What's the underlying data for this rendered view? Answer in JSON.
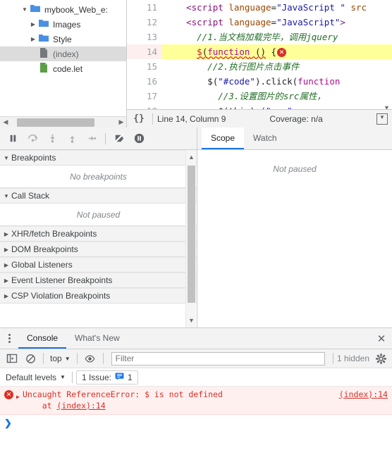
{
  "navigator": {
    "tree": [
      {
        "label": "mybook_Web_e:",
        "icon": "folder-icon",
        "twisty": "▼",
        "depth": 1,
        "type": "folder",
        "selected": false
      },
      {
        "label": "Images",
        "icon": "folder-icon",
        "twisty": "▶",
        "depth": 2,
        "type": "folder",
        "selected": false
      },
      {
        "label": "Style",
        "icon": "folder-icon",
        "twisty": "▶",
        "depth": 2,
        "type": "folder",
        "selected": false
      },
      {
        "label": "(index)",
        "icon": "document-icon",
        "twisty": "",
        "depth": 3,
        "type": "document",
        "selected": true
      },
      {
        "label": "code.let",
        "icon": "script-icon",
        "twisty": "",
        "depth": 3,
        "type": "script",
        "selected": false
      }
    ],
    "hscroll_left_arrow": "◀",
    "hscroll_right_arrow": "▶"
  },
  "editor": {
    "lines": [
      {
        "num": "11",
        "highlight": false,
        "tokens": [
          {
            "t": "    ",
            "c": "tk-plain"
          },
          {
            "t": "<script",
            "c": "tk-tag"
          },
          {
            "t": " ",
            "c": "tk-plain"
          },
          {
            "t": "language",
            "c": "tk-attr"
          },
          {
            "t": "=",
            "c": "tk-plain"
          },
          {
            "t": "\"JavaScript \"",
            "c": "tk-str"
          },
          {
            "t": " ",
            "c": "tk-plain"
          },
          {
            "t": "src",
            "c": "tk-attr"
          }
        ]
      },
      {
        "num": "12",
        "highlight": false,
        "tokens": [
          {
            "t": "    ",
            "c": "tk-plain"
          },
          {
            "t": "<script",
            "c": "tk-tag"
          },
          {
            "t": " ",
            "c": "tk-plain"
          },
          {
            "t": "language",
            "c": "tk-attr"
          },
          {
            "t": "=",
            "c": "tk-plain"
          },
          {
            "t": "\"JavaScript\"",
            "c": "tk-str"
          },
          {
            "t": ">",
            "c": "tk-tag"
          }
        ]
      },
      {
        "num": "13",
        "highlight": false,
        "tokens": [
          {
            "t": "        ",
            "c": "tk-plain"
          },
          {
            "t": "//1.当文档加载完毕，调用jquery",
            "c": "tk-cmt"
          }
        ]
      },
      {
        "num": "14",
        "highlight": true,
        "tokens": [
          {
            "t": "        ",
            "c": "tk-plain"
          },
          {
            "t": "$",
            "c": "tk-err"
          },
          {
            "t": "(",
            "c": "tk-plain"
          },
          {
            "t": "function",
            "c": "tk-kw"
          },
          {
            "t": " () {",
            "c": "tk-plain"
          }
        ]
      },
      {
        "num": "15",
        "highlight": false,
        "tokens": [
          {
            "t": "            ",
            "c": "tk-plain"
          },
          {
            "t": "//2.执行图片点击事件",
            "c": "tk-cmt"
          }
        ]
      },
      {
        "num": "16",
        "highlight": false,
        "tokens": [
          {
            "t": "            ",
            "c": "tk-plain"
          },
          {
            "t": "$",
            "c": "tk-plain"
          },
          {
            "t": "(",
            "c": "tk-plain"
          },
          {
            "t": "\"#code\"",
            "c": "tk-str"
          },
          {
            "t": ").",
            "c": "tk-plain"
          },
          {
            "t": "click",
            "c": "tk-plain"
          },
          {
            "t": "(",
            "c": "tk-plain"
          },
          {
            "t": "function",
            "c": "tk-kw"
          }
        ]
      },
      {
        "num": "17",
        "highlight": false,
        "tokens": [
          {
            "t": "                ",
            "c": "tk-plain"
          },
          {
            "t": "//3.设置图片的src属性，",
            "c": "tk-cmt"
          }
        ]
      },
      {
        "num": "18",
        "highlight": false,
        "tokens": [
          {
            "t": "                ",
            "c": "tk-plain"
          },
          {
            "t": "$(this).",
            "c": "tk-plain"
          },
          {
            "t": "(\"src\"",
            "c": "tk-str"
          }
        ]
      }
    ],
    "error_marker": "✕",
    "scroll_down_arrow": "▼"
  },
  "sources_status": {
    "format_icon": "{}",
    "line_column": "Line 14, Column 9",
    "coverage": "Coverage: n/a",
    "popout_icon": "▼"
  },
  "debugger": {
    "toolbar": [
      {
        "name": "pause-resume-button",
        "glyph": "pause"
      },
      {
        "name": "step-over-button",
        "glyph": "step-over"
      },
      {
        "name": "step-into-button",
        "glyph": "step-into"
      },
      {
        "name": "step-out-button",
        "glyph": "step-out"
      },
      {
        "name": "step-button",
        "glyph": "step"
      },
      {
        "name": "deactivate-breakpoints-button",
        "glyph": "deactivate"
      },
      {
        "name": "pause-on-exceptions-button",
        "glyph": "pause-exceptions"
      }
    ],
    "sections": [
      {
        "label": "Breakpoints",
        "twisty": "▼",
        "body": "No breakpoints",
        "expanded": true
      },
      {
        "label": "Call Stack",
        "twisty": "▼",
        "body": "Not paused",
        "expanded": true
      },
      {
        "label": "XHR/fetch Breakpoints",
        "twisty": "▶",
        "body": "",
        "expanded": false
      },
      {
        "label": "DOM Breakpoints",
        "twisty": "▶",
        "body": "",
        "expanded": false
      },
      {
        "label": "Global Listeners",
        "twisty": "▶",
        "body": "",
        "expanded": false
      },
      {
        "label": "Event Listener Breakpoints",
        "twisty": "▶",
        "body": "",
        "expanded": false
      },
      {
        "label": "CSP Violation Breakpoints",
        "twisty": "▶",
        "body": "",
        "expanded": false
      }
    ],
    "scroll_up_arrow": "▲",
    "scroll_down_arrow": "▼"
  },
  "scope_panel": {
    "tabs": [
      {
        "label": "Scope",
        "active": true
      },
      {
        "label": "Watch",
        "active": false
      }
    ],
    "body": "Not paused"
  },
  "drawer": {
    "tabs": [
      {
        "label": "Console",
        "active": true
      },
      {
        "label": "What's New",
        "active": false
      }
    ],
    "close_icon": "✕",
    "menu_icon": "kebab-menu-icon"
  },
  "console": {
    "toolbar": {
      "sidebar_toggle_icon": "console-sidebar-icon",
      "clear_icon": "clear-console-icon",
      "context": "top",
      "context_caret": "▼",
      "eye_icon": "live-expression-icon",
      "filter_placeholder": "Filter",
      "filter_value": "",
      "hidden_count": "1 hidden",
      "settings_icon": "gear-icon"
    },
    "levels": {
      "label": "Default levels",
      "caret": "▼",
      "issues_label": "1 Issue:",
      "issues_count": "1",
      "issues_icon": "issue-icon"
    },
    "messages": [
      {
        "type": "error",
        "icon": "error-icon",
        "expand_arrow": "▶",
        "text": "Uncaught ReferenceError: $ is not defined",
        "stack_prefix": "    at ",
        "stack_link": "(index):14",
        "source_link": "(index):14"
      }
    ],
    "prompt_arrow": "❯"
  },
  "colors": {
    "accent": "#1a73e8",
    "error": "#d93025",
    "highlight": "#ffff99",
    "folder": "#4a90e2",
    "script": "#5a9e47"
  }
}
